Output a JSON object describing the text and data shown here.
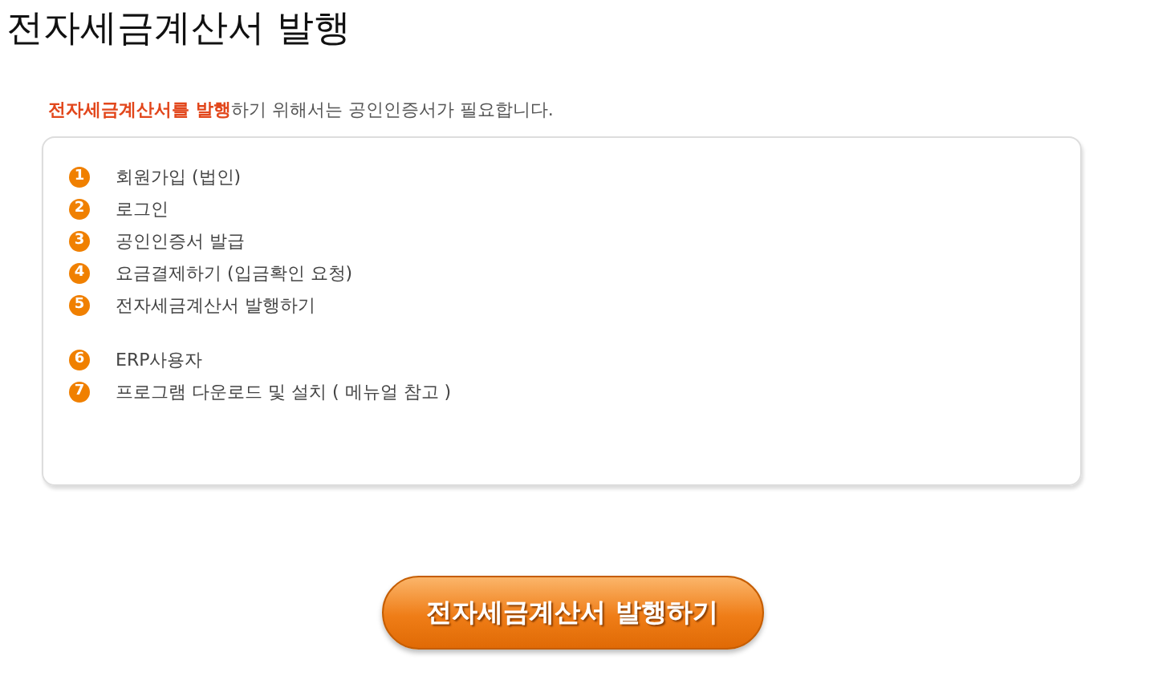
{
  "page_title": "전자세금계산서 발행",
  "intro": "**전자세금계산서를 발행**하기 위해서는 공인인증서가 필요합니다.",
  "step_groups": [
    {
      "steps": [
        {
          "number": "1",
          "text": "회원가입 (법인)"
        },
        {
          "number": "2",
          "text": "로그인"
        },
        {
          "number": "3",
          "text": "공인인증서 발급"
        },
        {
          "number": "4",
          "text": "요금결제하기 (입금확인 요청)"
        },
        {
          "number": "5",
          "text": "전자세금계산서 발행하기"
        }
      ]
    },
    {
      "steps": [
        {
          "number": "6",
          "text": "ERP사용자"
        },
        {
          "number": "7",
          "text": "프로그램 다운로드 및 설치 ( 메뉴얼 참고 )"
        }
      ]
    }
  ],
  "issue_button": "전자세금계산서 발행하기"
}
